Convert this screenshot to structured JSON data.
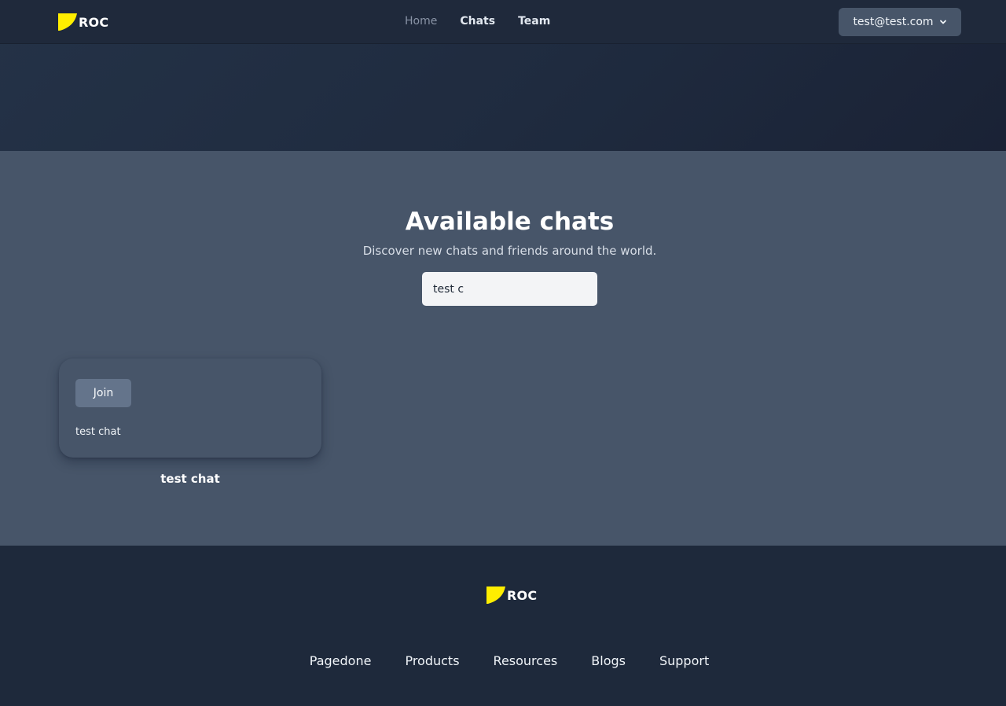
{
  "brand": {
    "name": "ROC",
    "logo_icon": "yellow-flag-logo",
    "accent": "#ffee00"
  },
  "nav": {
    "links": [
      {
        "label": "Home",
        "active": false
      },
      {
        "label": "Chats",
        "active": true
      },
      {
        "label": "Team",
        "active": true
      }
    ],
    "user_email": "test@test.com",
    "user_menu_icon": "chevron-down-icon"
  },
  "main": {
    "title": "Available chats",
    "subtitle": "Discover new chats and friends around the world.",
    "search": {
      "value": "test c",
      "placeholder": ""
    },
    "chats": [
      {
        "join_label": "Join",
        "description": "test chat",
        "name": "test chat"
      }
    ]
  },
  "footer": {
    "links": [
      "Pagedone",
      "Products",
      "Resources",
      "Blogs",
      "Support"
    ]
  },
  "colors": {
    "header_bg": "#1f293b",
    "main_bg": "#475569",
    "footer_bg": "#1e293b",
    "search_bg": "#f3f4f6",
    "button_bg": "#64748b"
  }
}
